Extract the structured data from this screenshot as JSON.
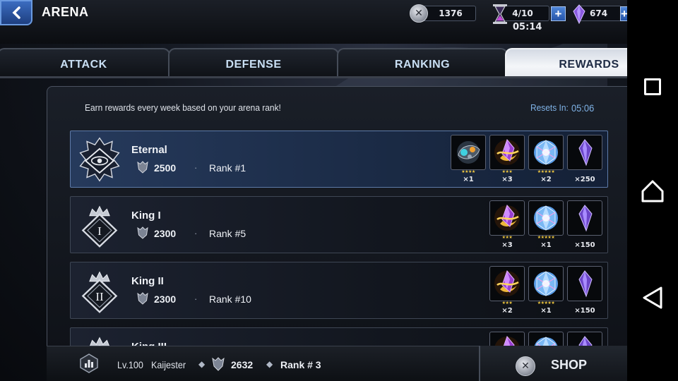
{
  "header": {
    "title": "ARENA",
    "coins": "1376",
    "energy": "4/10",
    "energy_timer": "05:14",
    "crystals": "674"
  },
  "tabs": [
    {
      "label": "ATTACK",
      "active": false
    },
    {
      "label": "DEFENSE",
      "active": false
    },
    {
      "label": "RANKING",
      "active": false
    },
    {
      "label": "REWARDS",
      "active": true
    }
  ],
  "panel": {
    "info": "Earn rewards every week based on your arena rank!",
    "resets_label": "Resets In:",
    "resets_value": "05:06"
  },
  "tiers": [
    {
      "name": "Eternal",
      "points": "2500",
      "rank": "Rank #1",
      "badge": "eye",
      "rewards": [
        {
          "icon": "gear-shard-icon",
          "stars": "★★★★",
          "qty": "×1"
        },
        {
          "icon": "gold-crystal-icon",
          "stars": "★★★",
          "qty": "×3"
        },
        {
          "icon": "gem-crystal-icon",
          "stars": "★★★★★",
          "qty": "×2"
        },
        {
          "icon": "purple-shard-icon",
          "stars": "",
          "qty": "×250"
        }
      ]
    },
    {
      "name": "King I",
      "points": "2300",
      "rank": "Rank #5",
      "badge": "I",
      "rewards": [
        {
          "icon": "gold-crystal-icon",
          "stars": "★★★",
          "qty": "×3"
        },
        {
          "icon": "gem-crystal-icon",
          "stars": "★★★★★",
          "qty": "×1"
        },
        {
          "icon": "purple-shard-icon",
          "stars": "",
          "qty": "×150"
        }
      ]
    },
    {
      "name": "King II",
      "points": "2300",
      "rank": "Rank #10",
      "badge": "II",
      "rewards": [
        {
          "icon": "gold-crystal-icon",
          "stars": "★★★",
          "qty": "×2"
        },
        {
          "icon": "gem-crystal-icon",
          "stars": "★★★★★",
          "qty": "×1"
        },
        {
          "icon": "purple-shard-icon",
          "stars": "",
          "qty": "×150"
        }
      ]
    },
    {
      "name": "King III",
      "points": "",
      "rank": "",
      "badge": "III",
      "rewards": [
        {
          "icon": "gold-crystal-icon",
          "stars": "",
          "qty": ""
        },
        {
          "icon": "gem-crystal-icon",
          "stars": "",
          "qty": ""
        },
        {
          "icon": "purple-shard-icon",
          "stars": "",
          "qty": ""
        }
      ]
    }
  ],
  "footer": {
    "level": "Lv.100",
    "name": "Kaijester",
    "points": "2632",
    "rank": "Rank # 3",
    "shop_label": "SHOP"
  }
}
